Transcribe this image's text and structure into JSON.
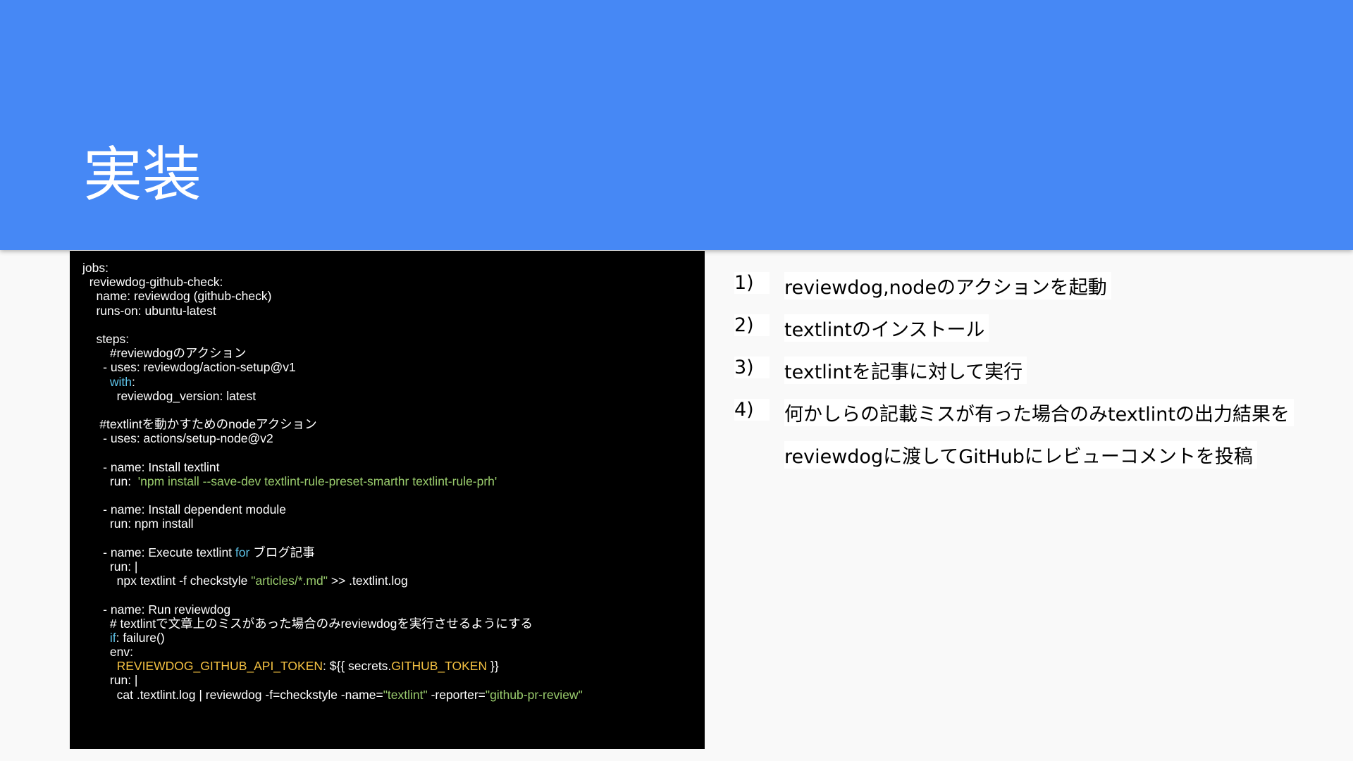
{
  "slide": {
    "title": "実装"
  },
  "code_lines": [
    [
      {
        "t": "jobs:"
      }
    ],
    [
      {
        "t": "  reviewdog-github-check:"
      }
    ],
    [
      {
        "t": "    name: reviewdog (github-check)"
      }
    ],
    [
      {
        "t": "    runs-on: ubuntu-latest"
      }
    ],
    [
      {
        "t": ""
      }
    ],
    [
      {
        "t": "    steps:"
      }
    ],
    [
      {
        "t": "        #reviewdogのアクション"
      }
    ],
    [
      {
        "t": "      - uses: reviewdog/action-setup@v1"
      }
    ],
    [
      {
        "t": "        "
      },
      {
        "t": "with",
        "c": "kw"
      },
      {
        "t": ":"
      }
    ],
    [
      {
        "t": "          reviewdog_version: latest"
      }
    ],
    [
      {
        "t": ""
      }
    ],
    [
      {
        "t": "     #textlintを動かすためのnodeアクション"
      }
    ],
    [
      {
        "t": "      - uses: actions/setup-node@v2"
      }
    ],
    [
      {
        "t": ""
      }
    ],
    [
      {
        "t": "      - name: Install textlint"
      }
    ],
    [
      {
        "t": "        run:  "
      },
      {
        "t": "'npm install --save-dev textlint-rule-preset-smarthr textlint-rule-prh'",
        "c": "str"
      }
    ],
    [
      {
        "t": ""
      }
    ],
    [
      {
        "t": "      - name: Install dependent module"
      }
    ],
    [
      {
        "t": "        run: npm install"
      }
    ],
    [
      {
        "t": ""
      }
    ],
    [
      {
        "t": "      - name: Execute textlint "
      },
      {
        "t": "for",
        "c": "kw"
      },
      {
        "t": " ブログ記事"
      }
    ],
    [
      {
        "t": "        run: |"
      }
    ],
    [
      {
        "t": "          npx textlint -f checkstyle "
      },
      {
        "t": "\"articles/*.md\"",
        "c": "str"
      },
      {
        "t": " >> .textlint.log"
      }
    ],
    [
      {
        "t": ""
      }
    ],
    [
      {
        "t": "      - name: Run reviewdog"
      }
    ],
    [
      {
        "t": "        # textlintで文章上のミスがあった場合のみreviewdogを実行させるようにする"
      }
    ],
    [
      {
        "t": "        "
      },
      {
        "t": "if",
        "c": "kw"
      },
      {
        "t": ": failure()"
      }
    ],
    [
      {
        "t": "        env:"
      }
    ],
    [
      {
        "t": "          "
      },
      {
        "t": "REVIEWDOG_GITHUB_API_TOKEN",
        "c": "var"
      },
      {
        "t": ": ${{ secrets."
      },
      {
        "t": "GITHUB_TOKEN",
        "c": "var"
      },
      {
        "t": " }}"
      }
    ],
    [
      {
        "t": "        run: |"
      }
    ],
    [
      {
        "t": "          cat .textlint.log | reviewdog -f=checkstyle -name="
      },
      {
        "t": "\"textlint\"",
        "c": "str"
      },
      {
        "t": " -reporter="
      },
      {
        "t": "\"github-pr-review\"",
        "c": "str"
      }
    ]
  ],
  "steps": [
    {
      "num": "1)",
      "text": "reviewdog,nodeのアクションを起動"
    },
    {
      "num": "2)",
      "text": "textlintのインストール"
    },
    {
      "num": "3)",
      "text": "textlintを記事に対して実行"
    },
    {
      "num": "4)",
      "text": "何かしらの記載ミスが有った場合のみtextlintの出力結果を"
    },
    {
      "num": "",
      "text": "reviewdogに渡してGitHubにレビューコメントを投稿"
    }
  ],
  "colors": {
    "header": "#4688f5",
    "keyword": "#5ec4ea",
    "string": "#9acc6d",
    "variable": "#f5c242"
  }
}
